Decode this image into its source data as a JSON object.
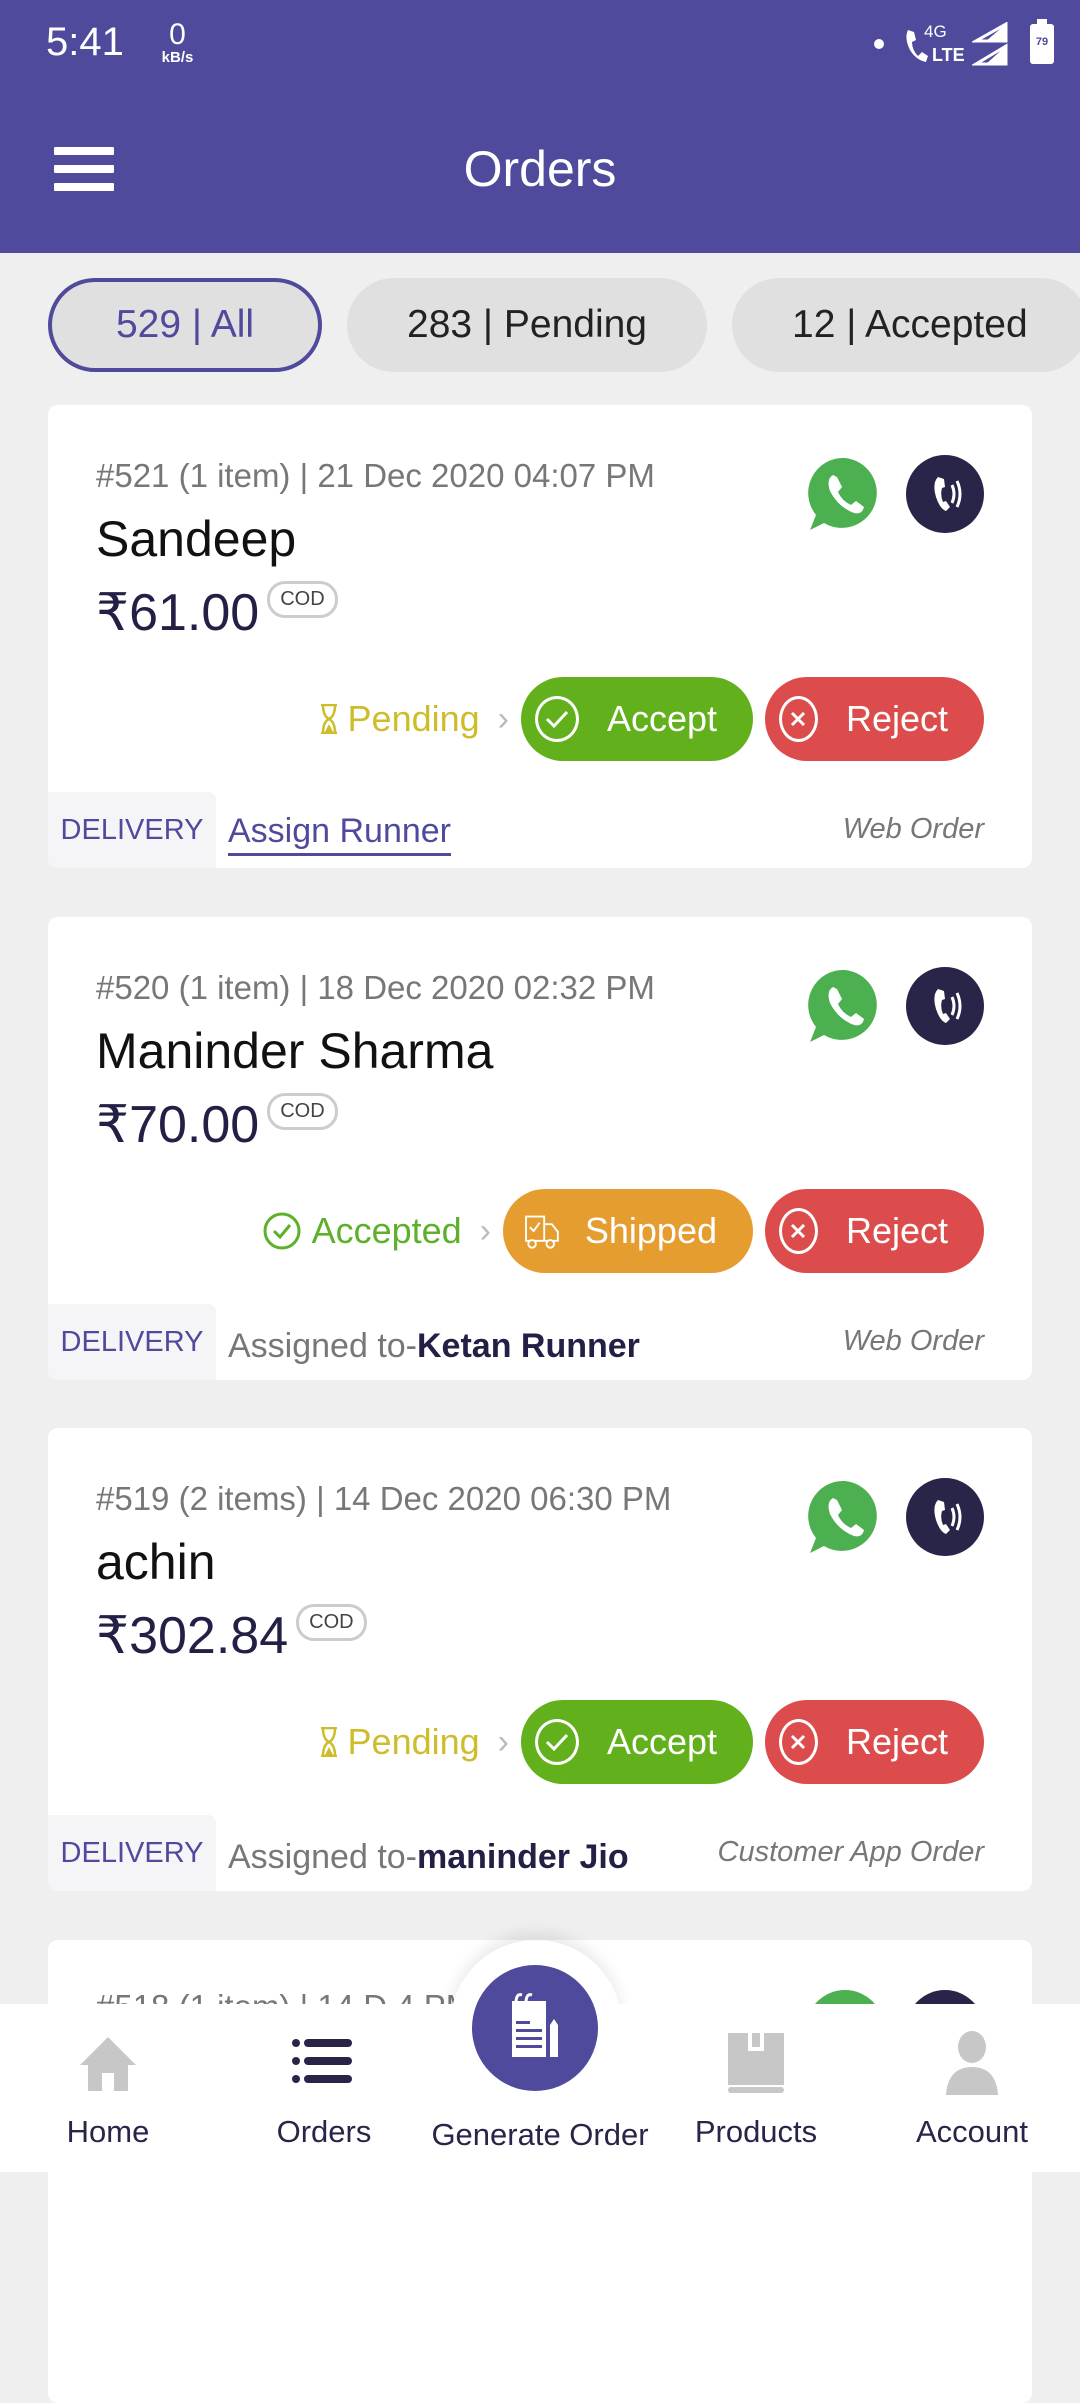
{
  "status_bar": {
    "time": "5:41",
    "speed_value": "0",
    "speed_unit": "kB/s",
    "network": "4G",
    "network_sub": "LTE",
    "battery": "79"
  },
  "header": {
    "title": "Orders",
    "menu_icon": "hamburger-menu-icon"
  },
  "filters": [
    {
      "label": "529 | All",
      "active": true
    },
    {
      "label": "283 | Pending",
      "active": false
    },
    {
      "label": "12 | Accepted",
      "active": false
    }
  ],
  "orders": [
    {
      "meta": "#521 (1 item) | 21 Dec 2020 04:07 PM",
      "customer": "Sandeep",
      "amount": "₹61.00",
      "payment": "COD",
      "status": "Pending",
      "primary_action": "Accept",
      "secondary_action": "Reject",
      "type": "DELIVERY",
      "runner_link": "Assign Runner",
      "source": "Web Order"
    },
    {
      "meta": "#520 (1 item) | 18 Dec 2020 02:32 PM",
      "customer": "Maninder Sharma",
      "amount": "₹70.00",
      "payment": "COD",
      "status": "Accepted",
      "primary_action": "Shipped",
      "secondary_action": "Reject",
      "type": "DELIVERY",
      "assigned_prefix": "Assigned to-",
      "assigned_name": "Ketan Runner",
      "source": "Web Order"
    },
    {
      "meta": "#519 (2 items) | 14 Dec 2020 06:30 PM",
      "customer": "achin",
      "amount": "₹302.84",
      "payment": "COD",
      "status": "Pending",
      "primary_action": "Accept",
      "secondary_action": "Reject",
      "type": "DELIVERY",
      "assigned_prefix": "Assigned to-",
      "assigned_name": "maninder Jio",
      "source": "Customer App Order"
    },
    {
      "meta": "#518 (1 item) | 14 D          4 PM"
    }
  ],
  "bottom_nav": [
    {
      "label": "Home",
      "icon": "home-icon"
    },
    {
      "label": "Orders",
      "icon": "list-icon"
    },
    {
      "label": "Generate Order",
      "icon": "notepad-pencil-icon"
    },
    {
      "label": "Products",
      "icon": "box-icon"
    },
    {
      "label": "Account",
      "icon": "person-icon"
    }
  ],
  "colors": {
    "brand": "#4f4a9c",
    "accept": "#62b01c",
    "shipped": "#e69d2f",
    "reject": "#dd4c4c",
    "pending": "#cdbd2a",
    "accepted": "#5db02a",
    "whatsapp": "#4caf50",
    "call": "#282548"
  }
}
